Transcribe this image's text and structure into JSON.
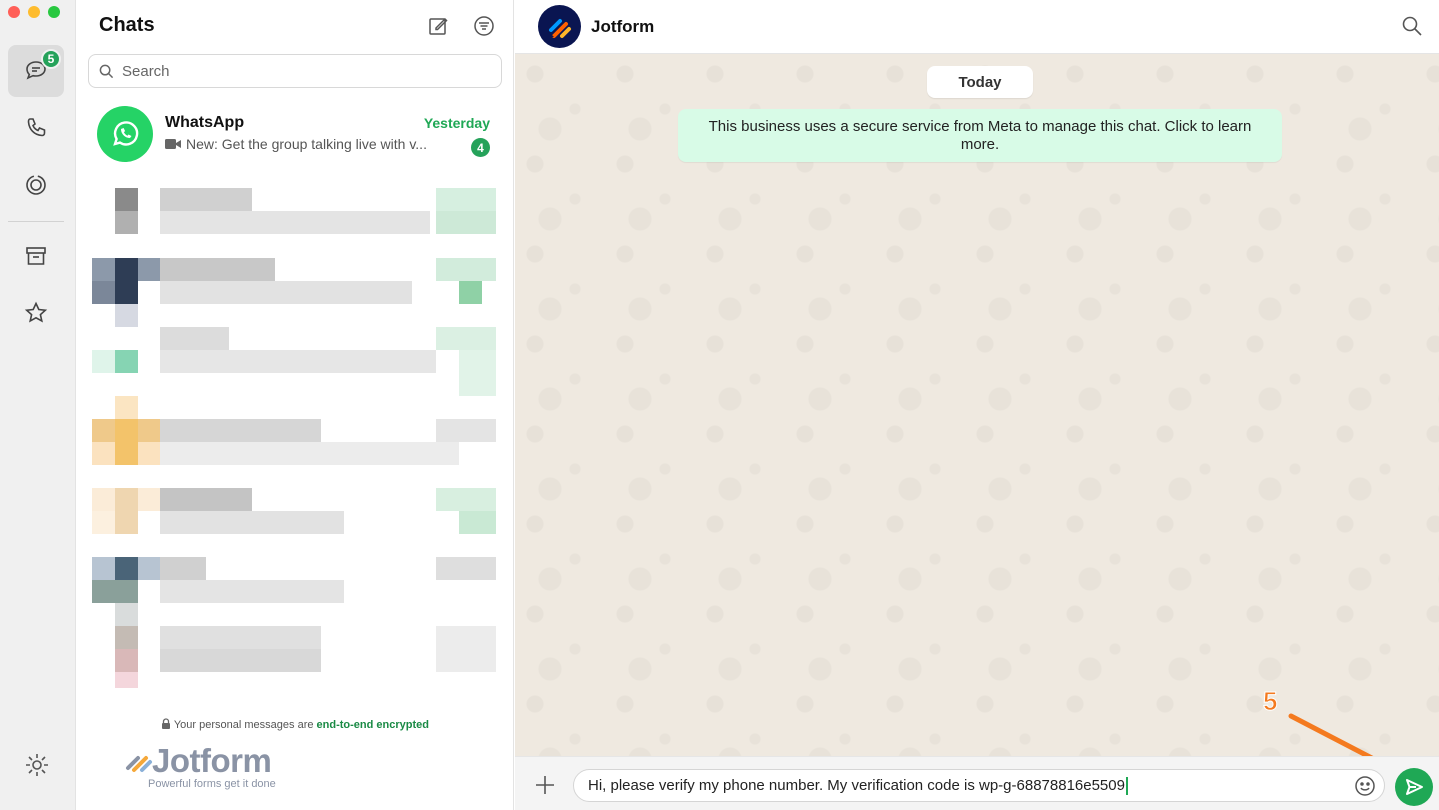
{
  "window": {
    "traffic_lights": [
      "#ff5f57",
      "#febc2e",
      "#28c840"
    ]
  },
  "rail": {
    "chats_badge": "5",
    "items": [
      "chats-icon",
      "calls-icon",
      "status-icon",
      "archive-icon",
      "starred-icon"
    ]
  },
  "chat_list": {
    "title": "Chats",
    "search_placeholder": "Search",
    "chats": [
      {
        "name": "WhatsApp",
        "time": "Yesterday",
        "preview": "New: Get the group talking live with v...",
        "unread": "4"
      }
    ],
    "encryption_note": "Your personal messages are ",
    "encryption_link": "end-to-end encrypted"
  },
  "watermark": {
    "brand": "Jotform",
    "tagline": "Powerful forms get it done"
  },
  "conversation": {
    "contact_name": "Jotform",
    "day_label": "Today",
    "system_message": "This business uses a secure service from Meta to manage this chat. Click to learn more.",
    "composer_text": "Hi, please verify my phone number. My verification code is wp-g-68878816e5509"
  },
  "annotation": {
    "step": "5",
    "color": "#f47a1f"
  },
  "colors": {
    "accent_green": "#1fa855",
    "wallpaper": "#efe9e0",
    "system_bubble": "#d8fbe7"
  }
}
